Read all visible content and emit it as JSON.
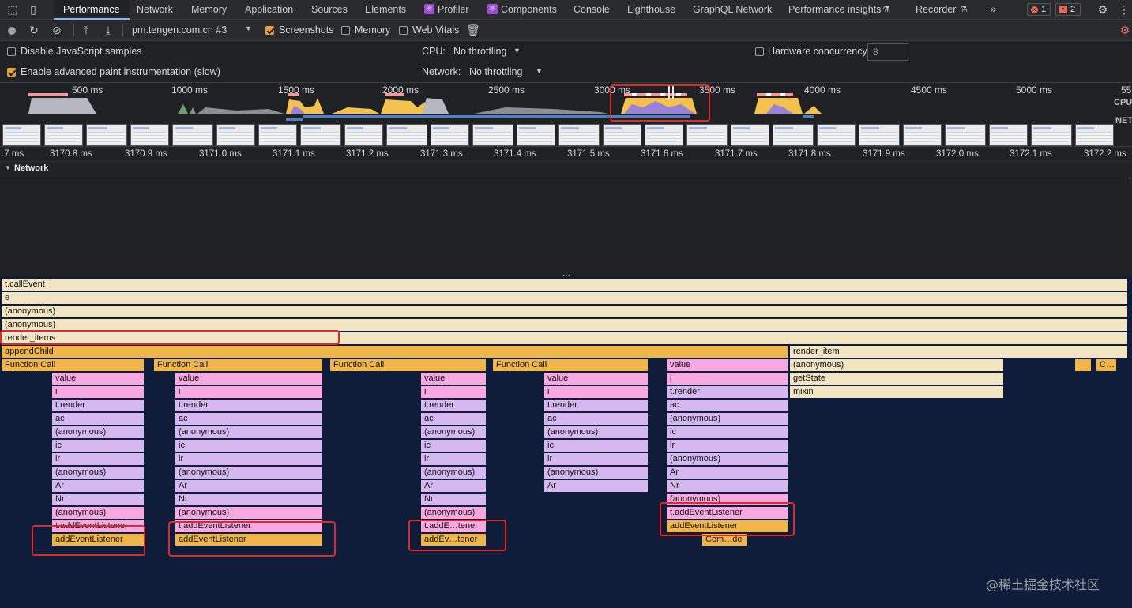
{
  "tabs": [
    "Performance",
    "Network",
    "Memory",
    "Application",
    "Sources",
    "Elements",
    "Profiler",
    "Components",
    "Console",
    "Lighthouse",
    "GraphQL Network",
    "Performance insights",
    "Recorder"
  ],
  "badges": {
    "errors": "1",
    "warnings": "2"
  },
  "toolbar": {
    "recording": "pm.tengen.com.cn #3",
    "screenshots": "Screenshots",
    "memory": "Memory",
    "web_vitals": "Web Vitals"
  },
  "settings": {
    "disable_js": "Disable JavaScript samples",
    "adv_paint": "Enable advanced paint instrumentation (slow)",
    "cpu_label": "CPU:",
    "cpu_value": "No throttling",
    "net_label": "Network:",
    "net_value": "No throttling",
    "hw_label": "Hardware concurrency",
    "hw_value": "8"
  },
  "overview_ticks": [
    "500 ms",
    "1000 ms",
    "1500 ms",
    "2000 ms",
    "2500 ms",
    "3000 ms",
    "3500 ms",
    "4000 ms",
    "4500 ms",
    "5000 ms",
    "55"
  ],
  "overview_labels": {
    "cpu": "CPU",
    "net": "NET"
  },
  "ruler_ticks": [
    ".7 ms",
    "3170.8 ms",
    "3170.9 ms",
    "3171.0 ms",
    "3171.1 ms",
    "3171.2 ms",
    "3171.3 ms",
    "3171.4 ms",
    "3171.5 ms",
    "3171.6 ms",
    "3171.7 ms",
    "3171.8 ms",
    "3171.9 ms",
    "3172.0 ms",
    "3172.1 ms",
    "3172.2 ms"
  ],
  "network_track": "Network",
  "flame": {
    "rows": [
      "t.callEvent",
      "e",
      "(anonymous)",
      "(anonymous)",
      "render_items"
    ],
    "append_child": "appendChild",
    "render_item": "render_item",
    "function_call": "Function Call",
    "stack1": [
      "value",
      "i",
      "t.render",
      "ac",
      "(anonymous)",
      "ic",
      "lr",
      "(anonymous)",
      "Ar",
      "Nr",
      "(anonymous)",
      "t.addEventListener",
      "addEventListener"
    ],
    "stack3": [
      "value",
      "i",
      "t.render",
      "ac",
      "(anonymous)",
      "ic",
      "lr",
      "(anonymous)",
      "Ar",
      "Nr",
      "(anonymous)",
      "t.addE…tener",
      "addEv…tener"
    ],
    "stack4": [
      "value",
      "i",
      "t.render",
      "ac",
      "(anonymous)",
      "ic",
      "lr",
      "(anonymous)",
      "Ar"
    ],
    "stack5": [
      "value",
      "i",
      "t.render",
      "ac",
      "(anonymous)",
      "ic",
      "lr",
      "(anonymous)",
      "Ar",
      "Nr",
      "(anonymous)",
      "t.addEventListener",
      "addEventListener"
    ],
    "com_de": "Com…de",
    "right_stack": [
      "(anonymous)",
      "getState",
      "mixin"
    ],
    "c_tiny": "C…"
  },
  "watermark": "@稀土掘金技术社区"
}
